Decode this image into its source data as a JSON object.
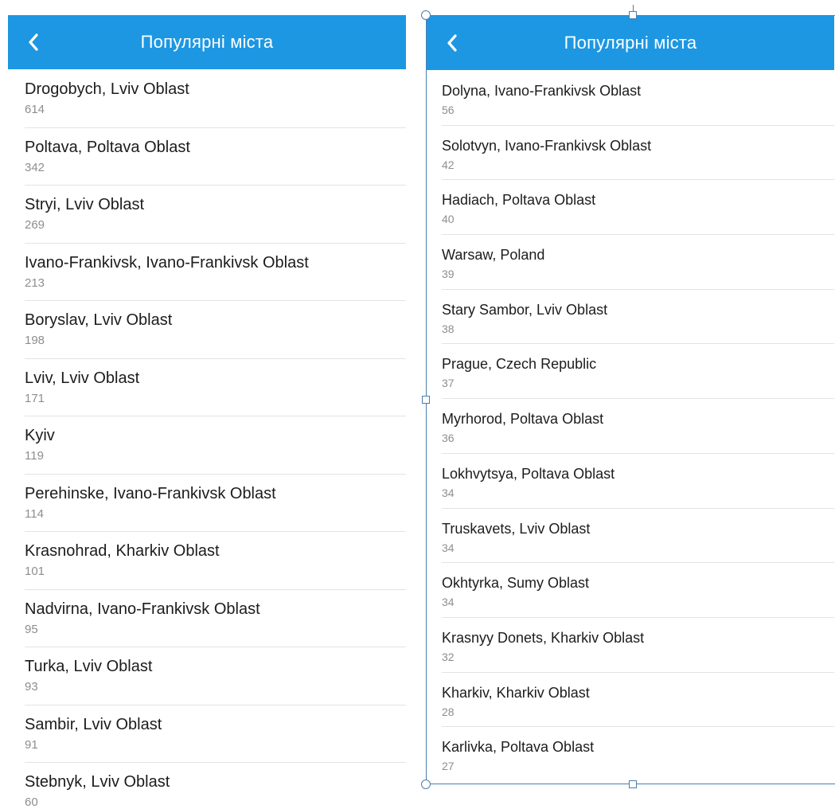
{
  "left": {
    "title": "Популярні міста",
    "cities": [
      {
        "name": "Drogobych, Lviv Oblast",
        "count": "614"
      },
      {
        "name": "Poltava, Poltava Oblast",
        "count": "342"
      },
      {
        "name": "Stryi, Lviv Oblast",
        "count": "269"
      },
      {
        "name": "Ivano-Frankivsk, Ivano-Frankivsk Oblast",
        "count": "213"
      },
      {
        "name": "Boryslav, Lviv Oblast",
        "count": "198"
      },
      {
        "name": "Lviv, Lviv Oblast",
        "count": "171"
      },
      {
        "name": "Kyiv",
        "count": "119"
      },
      {
        "name": "Perehinske, Ivano-Frankivsk Oblast",
        "count": "114"
      },
      {
        "name": "Krasnohrad, Kharkiv Oblast",
        "count": "101"
      },
      {
        "name": "Nadvirna, Ivano-Frankivsk Oblast",
        "count": "95"
      },
      {
        "name": "Turka, Lviv Oblast",
        "count": "93"
      },
      {
        "name": "Sambir, Lviv Oblast",
        "count": "91"
      },
      {
        "name": "Stebnyk, Lviv Oblast",
        "count": "60"
      }
    ]
  },
  "right": {
    "title": "Популярні міста",
    "cities": [
      {
        "name": "Dolyna, Ivano-Frankivsk Oblast",
        "count": "56"
      },
      {
        "name": "Solotvyn, Ivano-Frankivsk Oblast",
        "count": "42"
      },
      {
        "name": "Hadiach, Poltava Oblast",
        "count": "40"
      },
      {
        "name": "Warsaw, Poland",
        "count": "39"
      },
      {
        "name": "Stary Sambor, Lviv Oblast",
        "count": "38"
      },
      {
        "name": "Prague, Czech Republic",
        "count": "37"
      },
      {
        "name": "Myrhorod, Poltava Oblast",
        "count": "36"
      },
      {
        "name": "Lokhvytsya, Poltava Oblast",
        "count": "34"
      },
      {
        "name": "Truskavets, Lviv Oblast",
        "count": "34"
      },
      {
        "name": "Okhtyrka, Sumy Oblast",
        "count": "34"
      },
      {
        "name": "Krasnyy Donets, Kharkiv Oblast",
        "count": "32"
      },
      {
        "name": "Kharkiv, Kharkiv Oblast",
        "count": "28"
      },
      {
        "name": "Karlivka, Poltava Oblast",
        "count": "27"
      }
    ]
  },
  "colors": {
    "navbar": "#1d97e2",
    "divider": "#e3e3e3",
    "count_text": "#8e8e8e",
    "selection": "#4a7fb0"
  },
  "icons": {
    "back": "chevron-left-icon"
  }
}
